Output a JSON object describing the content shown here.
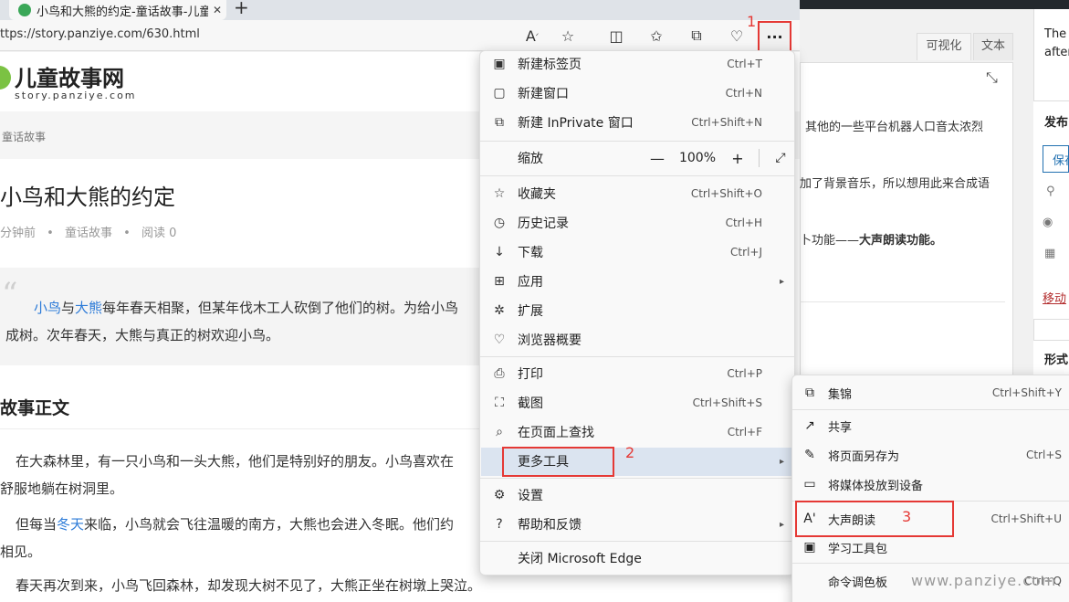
{
  "browser": {
    "tab_title": "小鸟和大熊的约定-童话故事-儿童",
    "tab_close": "✕",
    "new_tab": "+",
    "url": "ttps://story.panziye.com/630.html",
    "more_button": "···",
    "annotation_1": "1"
  },
  "site": {
    "name": "儿童故事网",
    "domain": "story.panziye.com",
    "breadcrumb": "童话故事"
  },
  "article": {
    "title": "小鸟和大熊的约定",
    "meta_time": "分钟前",
    "meta_dot": "•",
    "meta_category": "童话故事",
    "meta_reads": "阅读 0",
    "quote_mark": "“",
    "quote_link1": "小鸟",
    "quote_and": "与",
    "quote_link2": "大熊",
    "quote_rest": "每年春天相聚，但某年伐木工人砍倒了他们的树。为给小鸟",
    "quote_line2": "成树。次年春天，大熊与真正的树欢迎小鸟。",
    "section_title": "故事正文",
    "p1_line1": "在大森林里，有一只小鸟和一头大熊，他们是特别好的朋友。小鸟喜欢在",
    "p1_line2": "舒服地躺在树洞里。",
    "p2_pre": "但每当",
    "p2_link": "冬天",
    "p2_post": "来临，小鸟就会飞往温暖的南方，大熊也会进入冬眠。他们约",
    "p2_line2": "相见。",
    "p3_line1": "春天再次到来，小鸟飞回森林，却发现大树不见了，大熊正坐在树墩上哭泣。"
  },
  "wordpress": {
    "tab_visual": "可视化",
    "tab_text": "文本",
    "line1": "其他的一些平台机器人口音太浓烈",
    "line2": "加了背景音乐，所以想用此来合成语",
    "line3_pre": "卜功能——",
    "line3_bold": "大声朗读功能。",
    "side_top1": "The",
    "side_top2": "after",
    "publish": "发布",
    "save": "保存",
    "move": "移动",
    "format": "形式"
  },
  "menu": {
    "items": [
      {
        "label": "新建标签页",
        "shortcut": "Ctrl+T",
        "icon": "new-tab-icon",
        "glyph": "▣"
      },
      {
        "label": "新建窗口",
        "shortcut": "Ctrl+N",
        "icon": "new-window-icon",
        "glyph": "▢"
      },
      {
        "label": "新建 InPrivate 窗口",
        "shortcut": "Ctrl+Shift+N",
        "icon": "inprivate-icon",
        "glyph": "⧉"
      },
      {
        "label": "收藏夹",
        "shortcut": "Ctrl+Shift+O",
        "icon": "favorites-icon",
        "glyph": "☆"
      },
      {
        "label": "历史记录",
        "shortcut": "Ctrl+H",
        "icon": "history-icon",
        "glyph": "◷"
      },
      {
        "label": "下载",
        "shortcut": "Ctrl+J",
        "icon": "download-icon",
        "glyph": "↓"
      },
      {
        "label": "应用",
        "shortcut": "",
        "icon": "apps-icon",
        "glyph": "⊞"
      },
      {
        "label": "扩展",
        "shortcut": "",
        "icon": "extensions-icon",
        "glyph": "✲"
      },
      {
        "label": "浏览器概要",
        "shortcut": "",
        "icon": "browser-essentials-icon",
        "glyph": "♡"
      },
      {
        "label": "打印",
        "shortcut": "Ctrl+P",
        "icon": "print-icon",
        "glyph": "⎙"
      },
      {
        "label": "截图",
        "shortcut": "Ctrl+Shift+S",
        "icon": "screenshot-icon",
        "glyph": "⛶"
      },
      {
        "label": "在页面上查找",
        "shortcut": "Ctrl+F",
        "icon": "find-icon",
        "glyph": "⌕"
      },
      {
        "label": "更多工具",
        "shortcut": "",
        "icon": "more-tools-icon",
        "glyph": ""
      },
      {
        "label": "设置",
        "shortcut": "",
        "icon": "settings-icon",
        "glyph": "⚙"
      },
      {
        "label": "帮助和反馈",
        "shortcut": "",
        "icon": "help-icon",
        "glyph": "?"
      },
      {
        "label": "关闭 Microsoft Edge",
        "shortcut": "",
        "icon": "",
        "glyph": ""
      }
    ],
    "zoom_label": "缩放",
    "zoom_minus": "—",
    "zoom_value": "100%",
    "zoom_plus": "+",
    "zoom_full": "⤢",
    "arrow": "▸",
    "annotation_2": "2"
  },
  "submenu": {
    "items": [
      {
        "label": "集锦",
        "shortcut": "Ctrl+Shift+Y",
        "icon": "collections-icon",
        "glyph": "⧉"
      },
      {
        "label": "共享",
        "shortcut": "",
        "icon": "share-icon",
        "glyph": "↗"
      },
      {
        "label": "将页面另存为",
        "shortcut": "Ctrl+S",
        "icon": "save-as-icon",
        "glyph": "✎"
      },
      {
        "label": "将媒体投放到设备",
        "shortcut": "",
        "icon": "cast-icon",
        "glyph": "▭"
      },
      {
        "label": "大声朗读",
        "shortcut": "Ctrl+Shift+U",
        "icon": "read-aloud-icon",
        "glyph": "A'"
      },
      {
        "label": "学习工具包",
        "shortcut": "",
        "icon": "learning-toolkit-icon",
        "glyph": "▣"
      },
      {
        "label": "命令调色板",
        "shortcut": "Ctrl+Q",
        "icon": "",
        "glyph": ""
      }
    ],
    "annotation_3": "3"
  },
  "watermark": "www.panziye.com",
  "colors": {
    "annotation_red": "#e53935",
    "link_blue": "#2d7bd8",
    "highlight": "#dbe4f0"
  }
}
